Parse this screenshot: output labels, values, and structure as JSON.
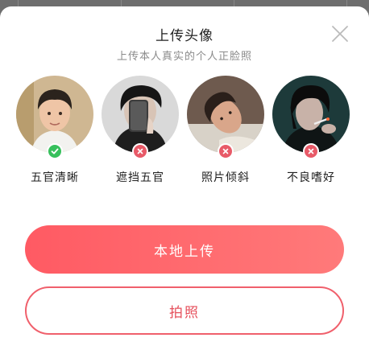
{
  "dialog": {
    "title": "上传头像",
    "subtitle": "上传本人真实的个人正脸照"
  },
  "examples": [
    {
      "label": "五官清晰",
      "status": "ok"
    },
    {
      "label": "遮挡五官",
      "status": "bad"
    },
    {
      "label": "照片倾斜",
      "status": "bad"
    },
    {
      "label": "不良嗜好",
      "status": "bad"
    }
  ],
  "buttons": {
    "upload_local": "本地上传",
    "take_photo": "拍照"
  },
  "colors": {
    "accent": "#ff5a63",
    "ok": "#37c05c",
    "bad": "#e85a68"
  }
}
